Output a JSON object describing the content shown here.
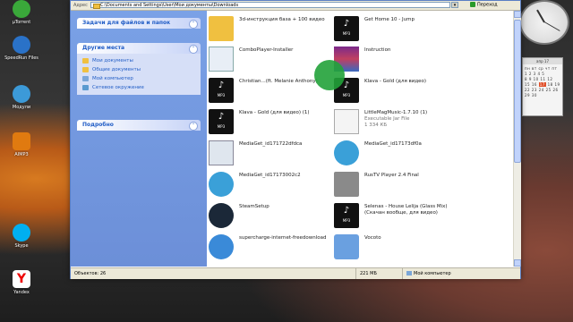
{
  "address": {
    "label": "Адрес",
    "path": "C:\\Documents and Settings\\User\\Мои документы\\Downloads",
    "go_label": "Переход"
  },
  "taskpane": {
    "tasks_title": "Задачи для файлов и папок",
    "places_title": "Другие места",
    "places": [
      "Мои документы",
      "Общие документы",
      "Мой компьютер",
      "Сетевое окружение"
    ],
    "details_title": "Подробно"
  },
  "files": [
    {
      "name": "3d-инструкция база + 100 видео",
      "sub": "",
      "icon": "folder-icon"
    },
    {
      "name": "Get Home 10 - Jump",
      "sub": "",
      "icon": "mp3-icon"
    },
    {
      "name": "ComboPlayer-Installer",
      "sub": "",
      "icon": "installer-icon"
    },
    {
      "name": "Instruction",
      "sub": "",
      "icon": "archive-icon"
    },
    {
      "name": "Christian...(ft. Melanie Anthony)",
      "sub": "",
      "icon": "mp3-icon"
    },
    {
      "name": "Klava - Gold (для видео) (1)",
      "sub": "",
      "icon": "mp3-icon"
    },
    {
      "name": "Klava - Gold (для видео)",
      "sub": "",
      "icon": "mp3-icon"
    },
    {
      "name": "LittleMagMusic-1.7.10 (1)",
      "sub": "Executable Jar File\n1 334 КБ",
      "icon": "jar-icon"
    },
    {
      "name": "MediaGet_id171722dfdca",
      "sub": "",
      "icon": "window-icon"
    },
    {
      "name": "MediaGet_id17173df0a",
      "sub": "",
      "icon": "download-icon"
    },
    {
      "name": "MediaGet_id17173002c2",
      "sub": "",
      "icon": "download-icon"
    },
    {
      "name": "RusTV Player 2.4 Final",
      "sub": "",
      "icon": "tv-icon"
    },
    {
      "name": "SteamSetup",
      "sub": "",
      "icon": "steam-icon"
    },
    {
      "name": "Selenas - House Lelija (Glass Mix) (Скачан вообще, для видео)",
      "sub": "",
      "icon": "mp3-icon"
    },
    {
      "name": "supercharge-internet-freedownload",
      "sub": "",
      "icon": "globe-icon"
    },
    {
      "name": "Vocoto",
      "sub": "",
      "icon": "setup-icon"
    }
  ],
  "status": {
    "objects": "Объектов: 26",
    "size": "221 МБ",
    "location": "Мой компьютер"
  },
  "desktop": {
    "icons": [
      "µTorrent",
      "SpeedRun Files",
      "Модули",
      "AIMP3",
      "Skype",
      "Yandex"
    ]
  },
  "calendar": {
    "header": "апр 17",
    "rows": [
      "пн вт ср чт пт",
      "1 2 3 4 5",
      "8 9 10 11 12",
      "15 16 17 18 19",
      "22 23 24 25 26",
      "29 30"
    ],
    "today": "17"
  },
  "colors": {
    "taskpane": "#6c8fd8",
    "link": "#215dc6",
    "cursor": "#22a23a"
  }
}
